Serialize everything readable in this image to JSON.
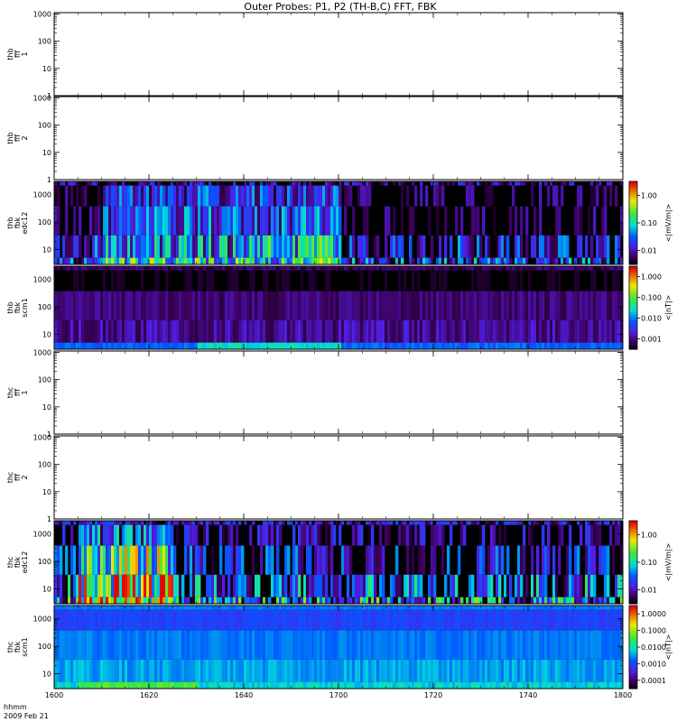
{
  "title": "Outer Probes: P1, P2 (TH-B,C) FFT, FBK",
  "footer": {
    "time_label": "hhmm",
    "date_label": "2009 Feb 21"
  },
  "colors": {
    "background": "#ffffff",
    "axis": "#000000",
    "spectrogram_base": "#000000"
  },
  "chart_data": [
    {
      "type": "heatmap",
      "panel_label": [
        "thb",
        "fff",
        "1"
      ],
      "has_data": false,
      "y_scale": "log",
      "ylim": [
        1,
        1000
      ],
      "y_ticks": [
        "1",
        "10",
        "100",
        "1000"
      ],
      "x_ticks": [
        "1600",
        "1620",
        "1640",
        "1700",
        "1720",
        "1740",
        "1800"
      ],
      "grid": false
    },
    {
      "type": "heatmap",
      "panel_label": [
        "thb",
        "fff",
        "2"
      ],
      "has_data": false,
      "y_scale": "log",
      "ylim": [
        1,
        1000
      ],
      "y_ticks": [
        "1",
        "10",
        "100",
        "1000"
      ],
      "x_ticks": [
        "1600",
        "1620",
        "1640",
        "1700",
        "1720",
        "1740",
        "1800"
      ],
      "grid": false
    },
    {
      "type": "heatmap",
      "panel_label": [
        "thb",
        "fbk",
        "edc12"
      ],
      "has_data": true,
      "y_scale": "log",
      "y_ticks": [
        "10",
        "100",
        "1000"
      ],
      "x_ticks": [
        "1600",
        "1620",
        "1640",
        "1700",
        "1720",
        "1740",
        "1800"
      ],
      "colorbar": {
        "label": "<|mV/m|>",
        "scale": "log",
        "ticks": [
          "1.00",
          "0.10",
          "0.01"
        ]
      },
      "bands": [
        {
          "name": "top",
          "level": 0.05,
          "variation": 0.25,
          "dropout": 0.02
        },
        {
          "name": "upper-mid",
          "level": 0.0,
          "variation": 0.2,
          "active_hhmm": [
            1610,
            1700
          ],
          "active_level": 0.25
        },
        {
          "name": "mid",
          "level": 0.0,
          "variation": 0.2,
          "active_hhmm": [
            1610,
            1700
          ],
          "active_level": 0.3
        },
        {
          "name": "low",
          "level": 0.15,
          "variation": 0.3,
          "active_hhmm": [
            1610,
            1700
          ],
          "active_level": 0.4
        },
        {
          "name": "bottom",
          "level": 0.25,
          "variation": 0.3,
          "active_hhmm": [
            1610,
            1700
          ],
          "active_level": 0.5
        }
      ]
    },
    {
      "type": "heatmap",
      "panel_label": [
        "thb",
        "fbk",
        "scm1"
      ],
      "has_data": true,
      "y_scale": "log",
      "y_ticks": [
        "10",
        "100",
        "1000"
      ],
      "x_ticks": [
        "1600",
        "1620",
        "1640",
        "1700",
        "1720",
        "1740",
        "1800"
      ],
      "colorbar": {
        "label": "<|nT|>",
        "scale": "log",
        "ticks": [
          "1.000",
          "0.100",
          "0.010",
          "0.001"
        ]
      },
      "bands": [
        {
          "name": "top",
          "level": 0.1,
          "variation": 0.05
        },
        {
          "name": "upper-mid",
          "level": 0.03,
          "variation": 0.03
        },
        {
          "name": "mid",
          "level": 0.12,
          "variation": 0.05
        },
        {
          "name": "low",
          "level": 0.15,
          "variation": 0.08
        },
        {
          "name": "bottom",
          "level": 0.35,
          "variation": 0.05,
          "active_hhmm": [
            1630,
            1700
          ],
          "active_level": 0.5
        }
      ]
    },
    {
      "type": "heatmap",
      "panel_label": [
        "thc",
        "fff",
        "1"
      ],
      "has_data": false,
      "y_scale": "log",
      "ylim": [
        1,
        1000
      ],
      "y_ticks": [
        "1",
        "10",
        "100",
        "1000"
      ],
      "x_ticks": [
        "1600",
        "1620",
        "1640",
        "1700",
        "1720",
        "1740",
        "1800"
      ],
      "grid": false
    },
    {
      "type": "heatmap",
      "panel_label": [
        "thc",
        "fff",
        "2"
      ],
      "has_data": false,
      "y_scale": "log",
      "ylim": [
        1,
        1000
      ],
      "y_ticks": [
        "1",
        "10",
        "100",
        "1000"
      ],
      "x_ticks": [
        "1600",
        "1620",
        "1640",
        "1700",
        "1720",
        "1740",
        "1800"
      ],
      "grid": false
    },
    {
      "type": "heatmap",
      "panel_label": [
        "thc",
        "fbk",
        "edc12"
      ],
      "has_data": true,
      "y_scale": "log",
      "y_ticks": [
        "10",
        "100",
        "1000"
      ],
      "x_ticks": [
        "1600",
        "1620",
        "1640",
        "1700",
        "1720",
        "1740",
        "1800"
      ],
      "colorbar": {
        "label": "<|mV/m|>",
        "scale": "log",
        "ticks": [
          "1.00",
          "0.10",
          "0.01"
        ]
      },
      "bands": [
        {
          "name": "top",
          "level": 0.15,
          "variation": 0.2
        },
        {
          "name": "upper-mid",
          "level": 0.05,
          "variation": 0.25,
          "active_hhmm": [
            1605,
            1625
          ],
          "active_level": 0.3
        },
        {
          "name": "mid",
          "level": 0.1,
          "variation": 0.35,
          "active_hhmm": [
            1605,
            1625
          ],
          "active_level": 0.55
        },
        {
          "name": "low",
          "level": 0.2,
          "variation": 0.4,
          "active_hhmm": [
            1605,
            1625
          ],
          "active_level": 0.7
        },
        {
          "name": "bottom",
          "level": 0.3,
          "variation": 0.4,
          "active_hhmm": [
            1605,
            1625
          ],
          "active_level": 0.75
        }
      ]
    },
    {
      "type": "heatmap",
      "panel_label": [
        "thc",
        "fbk",
        "scm1"
      ],
      "has_data": true,
      "y_scale": "log",
      "y_ticks": [
        "10",
        "100",
        "1000"
      ],
      "x_ticks": [
        "1600",
        "1620",
        "1640",
        "1700",
        "1720",
        "1740",
        "1800"
      ],
      "colorbar": {
        "label": "<|nT|>",
        "scale": "log",
        "ticks": [
          "1.0000",
          "0.1000",
          "0.0100",
          "0.0010",
          "0.0001"
        ]
      },
      "bands": [
        {
          "name": "top",
          "level": 0.38,
          "variation": 0.02
        },
        {
          "name": "upper-mid",
          "level": 0.3,
          "variation": 0.03
        },
        {
          "name": "mid",
          "level": 0.38,
          "variation": 0.03
        },
        {
          "name": "low",
          "level": 0.42,
          "variation": 0.05
        },
        {
          "name": "bottom",
          "level": 0.48,
          "variation": 0.05,
          "active_hhmm": [
            1605,
            1630
          ],
          "active_level": 0.62
        }
      ]
    }
  ]
}
